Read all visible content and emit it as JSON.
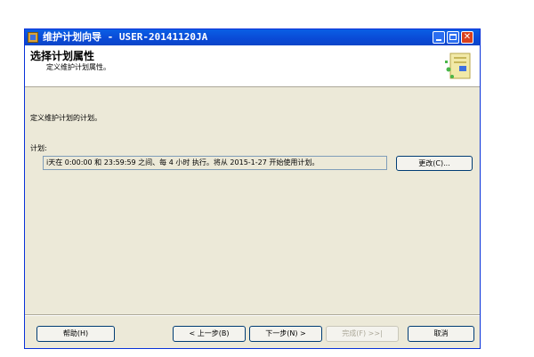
{
  "window": {
    "title": "维护计划向导 - USER-20141120JA"
  },
  "header": {
    "title": "选择计划属性",
    "subtitle": "定义维护计划属性。"
  },
  "content": {
    "description": "定义维护计划的计划。",
    "schedule_label": "计划:",
    "schedule_value": "i天在 0:00:00 和 23:59:59 之间、每 4 小时 执行。将从 2015-1-27 开始使用计划。",
    "change_button": "更改(C)..."
  },
  "footer": {
    "help_button": "帮助(H)",
    "back_button": "< 上一步(B)",
    "next_button": "下一步(N) >",
    "finish_button": "完成(F) >>|",
    "cancel_button": "取消"
  },
  "icons": {
    "app": "maintenance-plan-icon",
    "wizard": "wizard-graphic-icon"
  },
  "colors": {
    "titlebar": "#0a4ad6",
    "window_bg": "#ece9d8",
    "close_button": "#d9411e"
  }
}
